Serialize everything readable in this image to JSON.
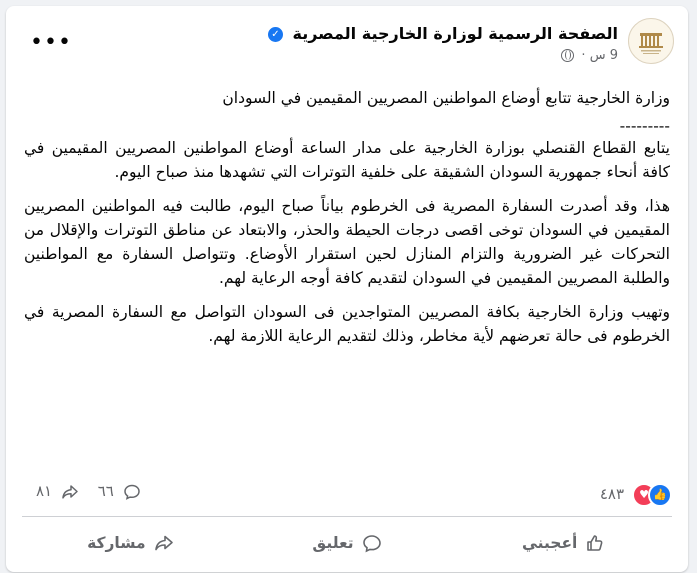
{
  "post": {
    "page_name": "الصفحة الرسمية لوزارة الخارجية المصرية",
    "time": "9 س",
    "separator": "·",
    "more_label": "•••",
    "paragraphs": [
      "وزارة الخارجية تتابع أوضاع المواطنين المصريين المقيمين في السودان",
      "---------",
      "يتابع القطاع القنصلي بوزارة الخارجية على مدار الساعة أوضاع المواطنين المصريين المقيمين في كافة أنحاء جمهورية السودان الشقيقة على خلفية التوترات التي تشهدها منذ صباح اليوم.",
      "هذا، وقد أصدرت السفارة المصرية فى الخرطوم بياناً صباح اليوم، طالبت فيه المواطنين المصريين المقيمين في السودان توخى اقصى درجات الحيطة والحذر، والابتعاد عن مناطق التوترات والإقلال من التحركات غير الضرورية والتزام المنازل لحين استقرار الأوضاع. وتتواصل السفارة مع المواطنين والطلبة المصريين المقيمين في السودان لتقديم كافة أوجه الرعاية لهم.",
      "وتهيب وزارة الخارجية بكافة المصريين المتواجدين فى السودان التواصل مع السفارة المصرية في الخرطوم فى حالة تعرضهم لأية مخاطر، وذلك لتقديم الرعاية اللازمة لهم."
    ]
  },
  "stats": {
    "reactions_count": "٤٨٣",
    "comments_count": "٦٦",
    "shares_count": "٨١"
  },
  "actions": {
    "like": "أعجبني",
    "comment": "تعليق",
    "share": "مشاركة"
  },
  "colors": {
    "accent": "#1877f2",
    "love": "#f33e58",
    "muted": "#65676b"
  },
  "icons": [
    "verified-badge-icon",
    "globe-icon",
    "more-icon",
    "like-reaction-icon",
    "love-reaction-icon",
    "comment-icon",
    "share-icon",
    "thumbs-up-icon"
  ]
}
